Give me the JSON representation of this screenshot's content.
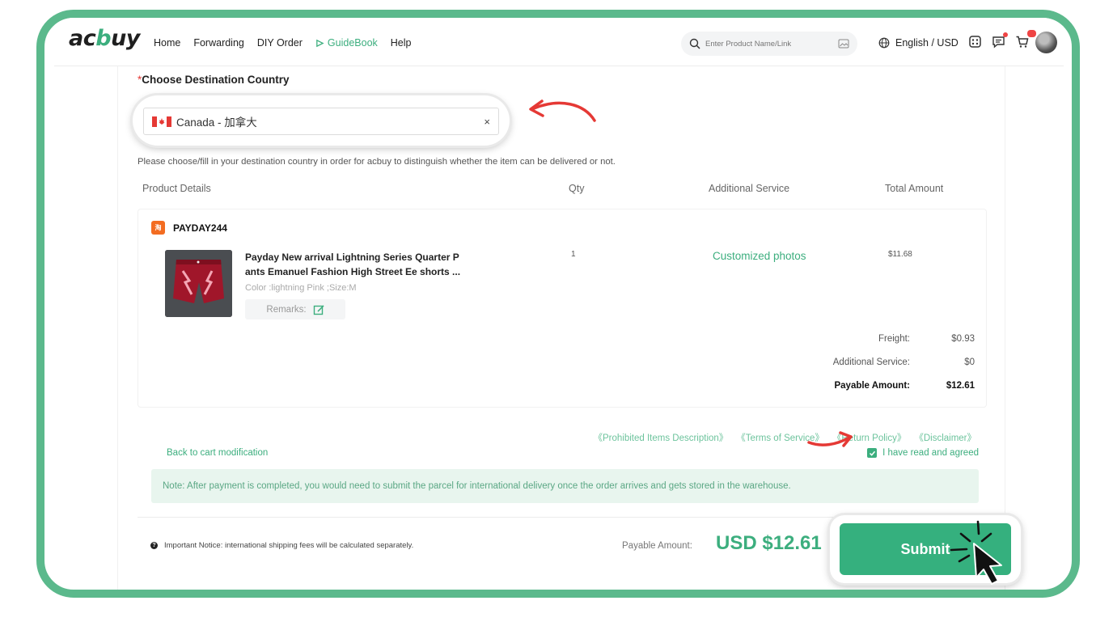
{
  "header": {
    "logo_text_a": "ac",
    "logo_text_b": "b",
    "logo_text_c": "uy",
    "nav": [
      "Home",
      "Forwarding",
      "DIY Order",
      "GuideBook",
      "Help"
    ],
    "search_placeholder": "Enter Product Name/Link",
    "language": "English / USD"
  },
  "destination": {
    "label": "Choose Destination Country",
    "required_mark": "*",
    "selected": "Canada - 加拿大",
    "clear": "×",
    "help": "Please choose/fill in your destination country in order for acbuy to distinguish whether the item can be delivered or not."
  },
  "table_headers": {
    "product": "Product Details",
    "qty": "Qty",
    "service": "Additional Service",
    "total": "Total Amount"
  },
  "order": {
    "store_icon": "淘",
    "store": "PAYDAY244",
    "title_line1": "Payday New arrival Lightning Series Quarter P",
    "title_line2": "ants Emanuel Fashion High Street Ee shorts ...",
    "attributes": "Color :lightning Pink ;Size:M",
    "remarks": "Remarks:",
    "qty": "1",
    "service": "Customized photos",
    "price": "$11.68"
  },
  "summary": {
    "freight_label": "Freight:",
    "freight": "$0.93",
    "service_label": "Additional Service:",
    "service": "$0",
    "payable_label": "Payable Amount:",
    "payable": "$12.61"
  },
  "policies": [
    "《Prohibited Items Description》",
    "《Terms of Service》",
    "《Return Policy》",
    "《Disclaimer》"
  ],
  "back_link": "Back to cart modification",
  "agree_text": "I have read and agreed",
  "agree_checked": true,
  "note": "Note: After payment is completed, you would need to submit the parcel for international delivery once the order arrives and gets stored in the warehouse.",
  "footer": {
    "important": "Important Notice: international shipping fees will be calculated separately.",
    "payable_label": "Payable Amount:",
    "payable_total": "USD $12.61",
    "submit": "Submit"
  },
  "colors": {
    "accent": "#3cae7e",
    "frame": "#5bb98c",
    "annotation": "#e53935"
  }
}
